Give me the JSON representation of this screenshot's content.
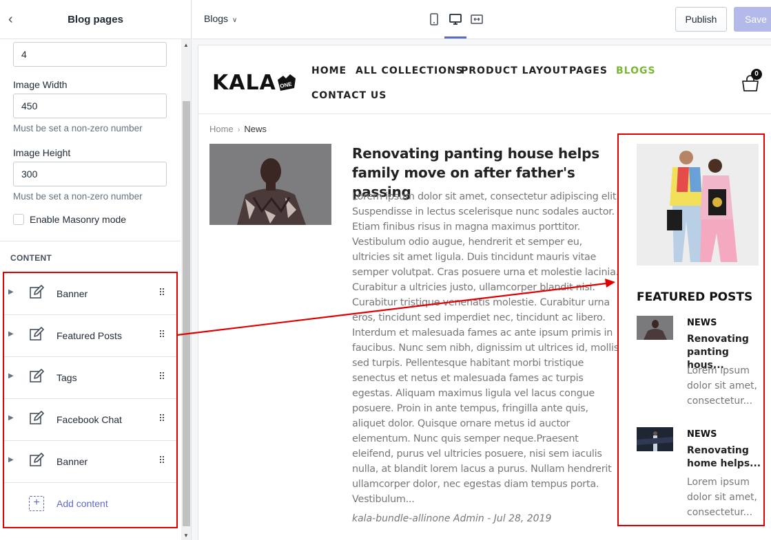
{
  "sidebar": {
    "title": "Blog pages",
    "fields": {
      "posts_per_row_value": "4",
      "image_width_label": "Image Width",
      "image_width_value": "450",
      "image_width_help": "Must be set a non-zero number",
      "image_height_label": "Image Height",
      "image_height_value": "300",
      "image_height_help": "Must be set a non-zero number",
      "masonry_label": "Enable Masonry mode"
    },
    "content_heading": "CONTENT",
    "content_items": [
      {
        "label": "Banner"
      },
      {
        "label": "Featured Posts"
      },
      {
        "label": "Tags"
      },
      {
        "label": "Facebook Chat"
      },
      {
        "label": "Banner"
      }
    ],
    "add_content_label": "Add content"
  },
  "topbar": {
    "template": "Blogs",
    "publish_label": "Publish",
    "save_label": "Save",
    "active_device": "desktop"
  },
  "store": {
    "logo_text": "KALA",
    "logo_badge": "ONE",
    "nav": [
      "HOME",
      "ALL COLLECTIONS",
      "PRODUCT LAYOUT",
      "PAGES",
      "BLOGS",
      "CONTACT US"
    ],
    "active_nav": "BLOGS",
    "cart_count": "0",
    "breadcrumb": {
      "home": "Home",
      "current": "News"
    },
    "post": {
      "title": "Renovating panting house helps family move on after father's passing",
      "excerpt": "Lorem ipsum dolor sit amet, consectetur adipiscing elit. Suspendisse in lectus scelerisque nunc sodales auctor. Etiam finibus risus in magna maximus porttitor. Vestibulum odio augue, hendrerit et semper eu, ultricies sit amet ligula. Duis tincidunt mauris vitae semper volutpat. Cras posuere urna et molestie lacinia. Curabitur a ultricies justo, ullamcorper blandit nisi. Curabitur tristique venenatis molestie. Curabitur urna eros, tincidunt sed imperdiet nec, tincidunt ac libero. Interdum et malesuada fames ac ante ipsum primis in faucibus. Nunc sem nibh, dignissim ut ultrices id, mollis sed turpis. Pellentesque habitant morbi tristique senectus et netus et malesuada fames ac turpis egestas. Aliquam maximus ligula vel lacus congue posuere. Proin in ante tempus, fringilla ante quis, aliquet dolor. Quisque ornare metus id auctor elementum. Nunc quis semper neque.Praesent eleifend, purus vel ultricies posuere, nisi sem iaculis nulla, at blandit lorem lacus a purus. Nullam hendrerit ullamcorper dolor, nec egestas diam tempus porta. Vestibulum...",
      "meta": "kala-bundle-allinone Admin - Jul 28, 2019"
    },
    "featured": {
      "heading": "FEATURED POSTS",
      "items": [
        {
          "category": "NEWS",
          "title": "Renovating panting hous...",
          "excerpt": "Lorem ipsum dolor sit amet, consectetur..."
        },
        {
          "category": "NEWS",
          "title": "Renovating home helps...",
          "excerpt": "Lorem ipsum dolor sit amet, consectetur..."
        }
      ]
    }
  },
  "colors": {
    "accent": "#5c6ac4",
    "nav_active": "#79b733",
    "annotation": "#e00000"
  },
  "icons": {
    "back": "chevron-left-icon",
    "content_item": "edit-icon",
    "drag": "drag-handle-icon",
    "add": "add-section-icon",
    "cart": "cart-icon"
  }
}
